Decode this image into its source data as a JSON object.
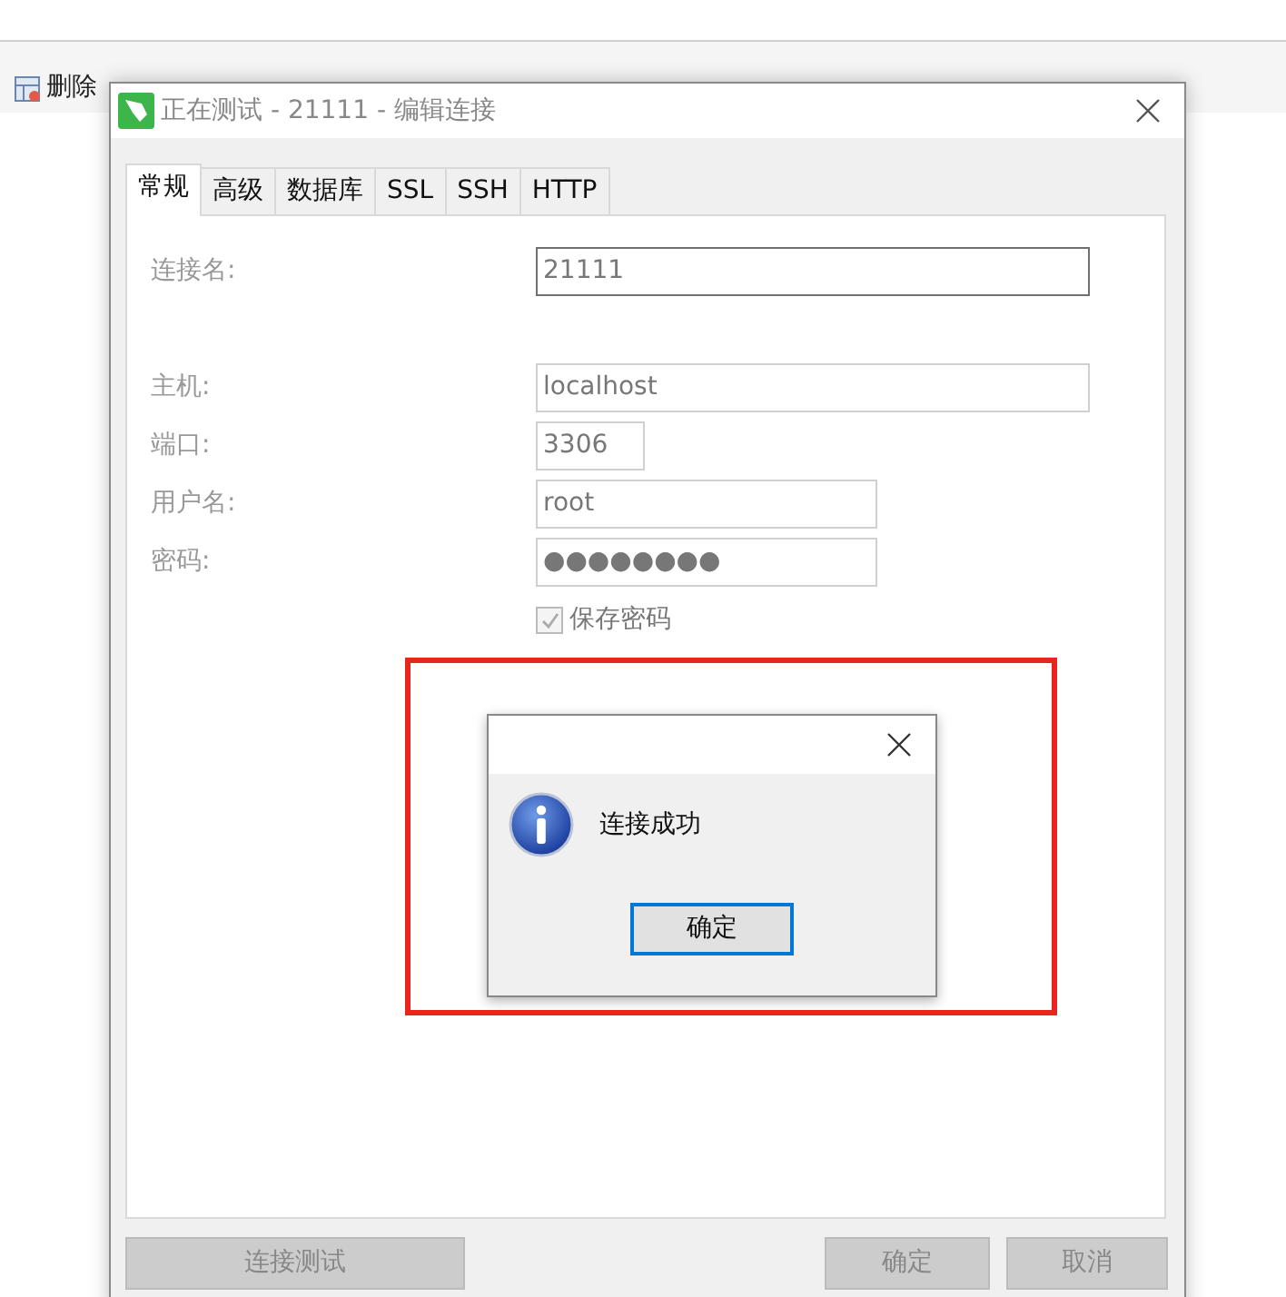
{
  "background_toolbar": {
    "items": [
      {
        "label": "删除"
      }
    ]
  },
  "dialog": {
    "title": "正在测试 - 21111 - 编辑连接",
    "tabs": [
      {
        "label": "常规",
        "selected": true
      },
      {
        "label": "高级",
        "selected": false
      },
      {
        "label": "数据库",
        "selected": false
      },
      {
        "label": "SSL",
        "selected": false
      },
      {
        "label": "SSH",
        "selected": false
      },
      {
        "label": "HTTP",
        "selected": false
      }
    ],
    "fields": [
      {
        "label": "连接名:",
        "value": "21111",
        "focused": true
      },
      {
        "label": "主机:",
        "value": "localhost",
        "focused": false
      },
      {
        "label": "端口:",
        "value": "3306",
        "focused": false
      },
      {
        "label": "用户名:",
        "value": "root",
        "focused": false
      },
      {
        "label": "密码:",
        "value": "●●●●●●●●",
        "focused": false
      }
    ],
    "save_password": {
      "label": "保存密码",
      "checked": true,
      "disabled": true
    },
    "buttons": [
      {
        "label": "连接测试",
        "disabled": true
      },
      {
        "label": "确定",
        "disabled": true
      },
      {
        "label": "取消",
        "disabled": true
      }
    ]
  },
  "message_box": {
    "message": "连接成功",
    "button": {
      "label": "确定",
      "focused": true
    }
  }
}
